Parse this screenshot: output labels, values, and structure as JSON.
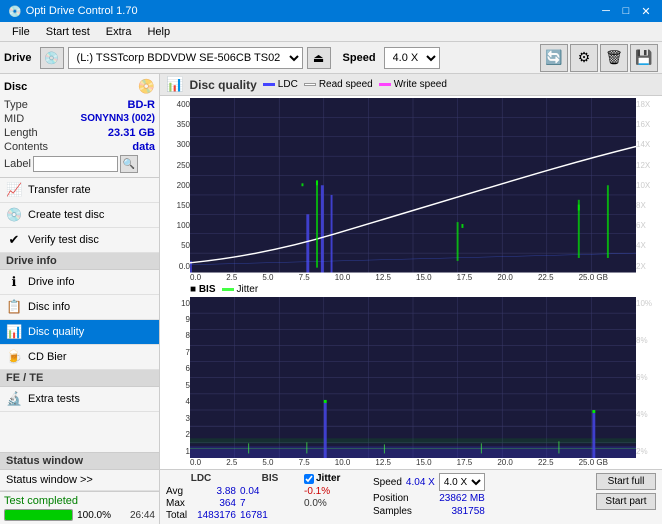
{
  "titleBar": {
    "title": "Opti Drive Control 1.70",
    "controls": [
      "minimize",
      "maximize",
      "close"
    ]
  },
  "menuBar": {
    "items": [
      "File",
      "Start test",
      "Extra",
      "Help"
    ]
  },
  "driveBar": {
    "driveLabel": "Drive",
    "driveValue": "(L:)  TSSTcorp BDDVDW SE-506CB TS02",
    "speedLabel": "Speed",
    "speedValue": "4.0 X"
  },
  "disc": {
    "title": "Disc",
    "typeLabel": "Type",
    "typeValue": "BD-R",
    "midLabel": "MID",
    "midValue": "SONYNN3 (002)",
    "lengthLabel": "Length",
    "lengthValue": "23.31 GB",
    "contentsLabel": "Contents",
    "contentsValue": "data",
    "labelLabel": "Label",
    "labelValue": ""
  },
  "nav": {
    "items": [
      {
        "id": "transfer-rate",
        "label": "Transfer rate",
        "icon": "📈"
      },
      {
        "id": "create-test-disc",
        "label": "Create test disc",
        "icon": "💿"
      },
      {
        "id": "verify-test-disc",
        "label": "Verify test disc",
        "icon": "✔"
      },
      {
        "id": "drive-info",
        "label": "Drive info",
        "icon": "ℹ"
      },
      {
        "id": "disc-info",
        "label": "Disc info",
        "icon": "📋"
      },
      {
        "id": "disc-quality",
        "label": "Disc quality",
        "icon": "📊",
        "active": true
      },
      {
        "id": "cd-bier",
        "label": "CD Bier",
        "icon": "🍺"
      },
      {
        "id": "fe-te",
        "label": "FE / TE",
        "icon": "📉"
      },
      {
        "id": "extra-tests",
        "label": "Extra tests",
        "icon": "🔬"
      }
    ]
  },
  "statusWindow": {
    "label": "Status window >>",
    "statusText": "Test completed",
    "progressValue": 100,
    "progressLabel": "100.0%",
    "timeLabel": "26:44"
  },
  "chart": {
    "title": "Disc quality",
    "legend": [
      {
        "label": "LDC",
        "color": "#4444ff"
      },
      {
        "label": "Read speed",
        "color": "#ffffff"
      },
      {
        "label": "Write speed",
        "color": "#ff44ff"
      }
    ],
    "upperChart": {
      "yMax": 400,
      "yLabels": [
        "400",
        "350",
        "300",
        "250",
        "200",
        "150",
        "100",
        "50",
        "0.0"
      ],
      "yLabelsRight": [
        "18X",
        "16X",
        "14X",
        "12X",
        "10X",
        "8X",
        "6X",
        "4X",
        "2X"
      ],
      "xLabels": [
        "0.0",
        "2.5",
        "5.0",
        "7.5",
        "10.0",
        "12.5",
        "15.0",
        "17.5",
        "20.0",
        "22.5",
        "25.0 GB"
      ]
    },
    "lowerChart": {
      "title": "BIS",
      "legend": [
        {
          "label": "Jitter",
          "color": "#44ff44"
        }
      ],
      "yMax": 10,
      "yLabels": [
        "10",
        "9",
        "8",
        "7",
        "6",
        "5",
        "4",
        "3",
        "2",
        "1"
      ],
      "yLabelsRight": [
        "10%",
        "8%",
        "6%",
        "4%",
        "2%"
      ],
      "xLabels": [
        "0.0",
        "2.5",
        "5.0",
        "7.5",
        "10.0",
        "12.5",
        "15.0",
        "17.5",
        "20.0",
        "22.5",
        "25.0 GB"
      ]
    }
  },
  "stats": {
    "ldcHeader": "LDC",
    "bisHeader": "BIS",
    "jitterHeader": "Jitter",
    "speedHeader": "Speed",
    "avgLabel": "Avg",
    "maxLabel": "Max",
    "totalLabel": "Total",
    "ldcAvg": "3.88",
    "ldcMax": "364",
    "ldcTotal": "1483176",
    "bisAvg": "0.04",
    "bisMax": "7",
    "bisTotal": "16781",
    "jitterAvg": "-0.1%",
    "jitterMax": "0.0%",
    "speedVal": "4.04 X",
    "speedSelect": "4.0 X",
    "positionLabel": "Position",
    "positionVal": "23862 MB",
    "samplesLabel": "Samples",
    "samplesVal": "381758",
    "startFull": "Start full",
    "startPart": "Start part",
    "jitterChecked": true,
    "jitterLabel": "Jitter"
  }
}
